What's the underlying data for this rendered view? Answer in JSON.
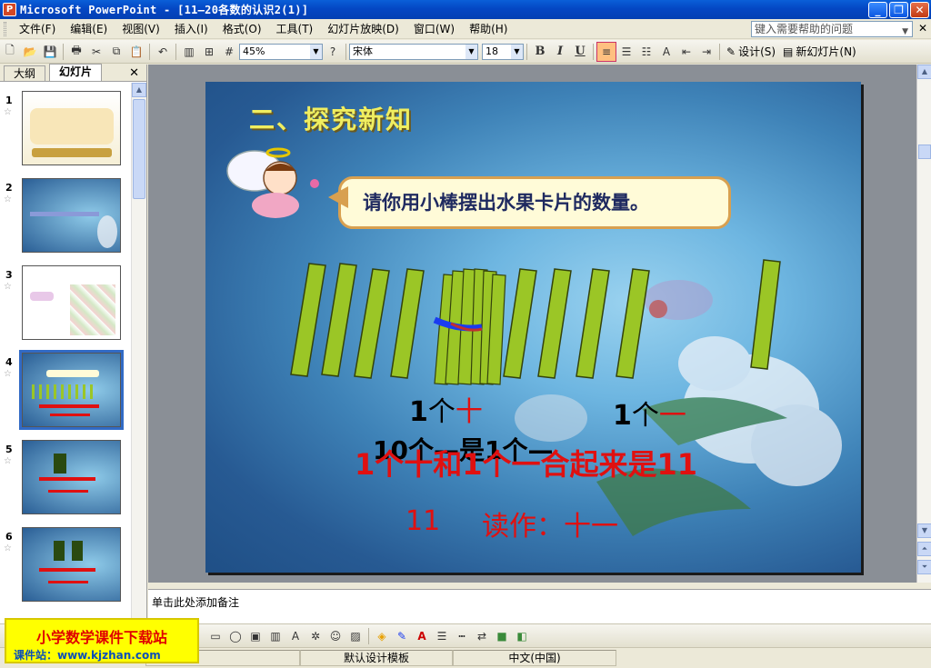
{
  "window": {
    "title": "Microsoft PowerPoint - [11—20各数的认识2(1)]"
  },
  "menu": [
    "文件(F)",
    "编辑(E)",
    "视图(V)",
    "插入(I)",
    "格式(O)",
    "工具(T)",
    "幻灯片放映(D)",
    "窗口(W)",
    "帮助(H)"
  ],
  "help_placeholder": "键入需要帮助的问题",
  "toolbar": {
    "zoom": "45%",
    "font": "宋体",
    "font_size": "18",
    "bold": "B",
    "italic": "I",
    "underline": "U",
    "design": "设计(S)",
    "new_slide": "新幻灯片(N)"
  },
  "pane": {
    "tab_outline": "大纲",
    "tab_slides": "幻灯片",
    "slides": [
      "1",
      "2",
      "3",
      "4",
      "5",
      "6"
    ],
    "selected": "4"
  },
  "slide": {
    "title": "二、探究新知",
    "bubble": "请你用小棒摆出水果卡片的数量。",
    "tens_one": "1",
    "tens_unit": "个",
    "tens_word": "十",
    "ones_one": "1",
    "ones_unit": "个",
    "ones_word": "一",
    "line_black": "10个—是1个—",
    "line_red": "1个十和1个一合起来是11",
    "number": "11",
    "read_as": "读作：十一"
  },
  "notes_placeholder": "单击此处添加备注",
  "status": {
    "template": "默认设计模板",
    "language": "中文(中国)"
  },
  "watermark": {
    "title": "小学数学课件下载站",
    "subtitle": "课件站：www.kjzhan.com"
  },
  "colors": {
    "slide_title": "#f0ee60",
    "red_text": "#e01010",
    "stick": "#9bc626",
    "band": "#1a3cf0"
  }
}
